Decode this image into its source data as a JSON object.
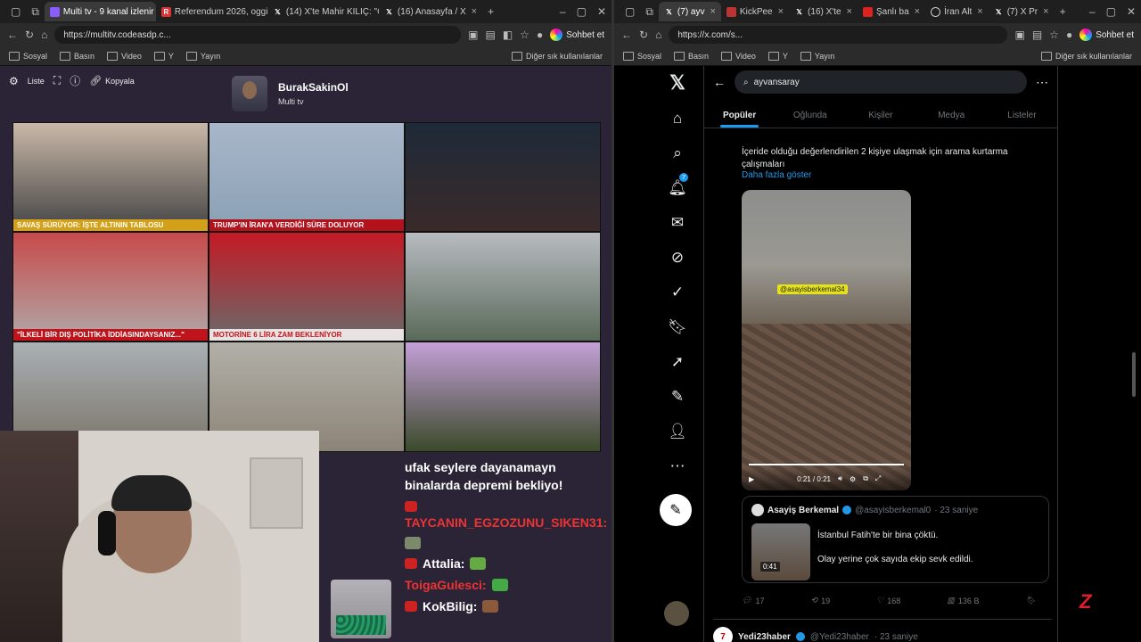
{
  "left_browser": {
    "tabs": [
      {
        "label": "Multi tv - 9 kanal izlenir",
        "fav_color": "#8a5cff",
        "active": true
      },
      {
        "label": "Referendum 2026, oggi",
        "fav_color": "#d33",
        "active": false
      },
      {
        "label": "(14) X'te Mahir KILIÇ: \"G",
        "fav_color": "#111",
        "active": false
      },
      {
        "label": "(16) Anasayfa / X",
        "fav_color": "#111",
        "active": false
      }
    ],
    "url": "https://multitv.codeasdp.c...",
    "copilot_label": "Sohbet et",
    "bookmarks": [
      "Sosyal",
      "Basın",
      "Video",
      "Y",
      "Yayın"
    ],
    "bookmarks_other": "Diğer sık kullanılanlar"
  },
  "multitv": {
    "toolbar": {
      "list_label": "Liste",
      "copy_label": "Kopyala"
    },
    "profile": {
      "name": "BurakSakinOl",
      "subtitle": "Multi tv"
    },
    "tiles": [
      {
        "caption": "SAVAŞ SÜRÜYOR: İŞTE ALTININ TABLOSU",
        "cap_bg": "#d4a017",
        "bg": "linear-gradient(#c9b8a8,#444)"
      },
      {
        "caption": "TRUMP'IN İRAN'A VERDİĞİ SÜRE DOLUYOR",
        "cap_bg": "#b3121d",
        "bg": "linear-gradient(#a8b7c9,#8aa0b4)"
      },
      {
        "caption": "",
        "cap_bg": "transparent",
        "bg": "linear-gradient(#1e2a38,#3a2a2a)"
      },
      {
        "caption": "\"İLKELİ BİR DIŞ POLİTİKA İDDİASINDAYSANIZ...\"",
        "cap_bg": "#c0141c",
        "bg": "linear-gradient(#c84a4a,#b0a8a8)"
      },
      {
        "caption": "MOTORİNE 6 LİRA ZAM BEKLENİYOR",
        "cap_bg": "#e8e2e2",
        "bg": "linear-gradient(#c41a24,#6a6a6a)"
      },
      {
        "caption": "",
        "cap_bg": "transparent",
        "bg": "linear-gradient(#b8bcc0,#5a6a5a)"
      },
      {
        "caption": "",
        "cap_bg": "transparent",
        "bg": "linear-gradient(#aab0b4,#7a7468)"
      },
      {
        "caption": "",
        "cap_bg": "transparent",
        "bg": "linear-gradient(#b2b0a8,#8c8478)"
      },
      {
        "caption": "",
        "cap_bg": "transparent",
        "bg": "linear-gradient(#c4a0d8,#3a4a2a)"
      }
    ]
  },
  "chat": {
    "big_message": "ufak seylere dayanamayn binalarda depremi bekliyo!",
    "messages": [
      {
        "user": "TAYCANIN_EGZOZUNU_SIKEN31:",
        "color": "#e33"
      },
      {
        "user": "Attalia:",
        "color": "#fff"
      },
      {
        "user": "ToigaGulesci:",
        "color": "#e33"
      },
      {
        "user": "KokBilig:",
        "color": "#fff"
      }
    ]
  },
  "right_browser": {
    "tabs": [
      {
        "label": "(7) ayv",
        "active": true
      },
      {
        "label": "KickPee",
        "active": false
      },
      {
        "label": "(16) X'te",
        "active": false
      },
      {
        "label": "Şanlı ba",
        "active": false
      },
      {
        "label": "İran Alt",
        "active": false
      },
      {
        "label": "(7) X Pr",
        "active": false
      }
    ],
    "url": "https://x.com/s...",
    "copilot_label": "Sohbet et",
    "bookmarks": [
      "Sosyal",
      "Basın",
      "Video",
      "Y",
      "Yayın"
    ],
    "bookmarks_other": "Diğer sık kullanılanlar"
  },
  "x": {
    "search_value": "ayvansaray",
    "notification_count": "7",
    "tabs": [
      "Popüler",
      "Oğlunda",
      "Kişiler",
      "Medya",
      "Listeler"
    ],
    "tweet_text": "İçeride olduğu değerlendirilen 2 kişiye ulaşmak için arama kurtarma çalışmaları",
    "show_more": "Daha fazla göster",
    "video_tag": "@asayisberkemal34",
    "video_time": "0:21 / 0:21",
    "quote": {
      "name": "Asayiş Berkemal",
      "handle": "@asayisberkemal0",
      "time": "· 23 saniye",
      "line1": "İstanbul Fatih'te bir bina çöktü.",
      "line2": "Olay yerine çok sayıda ekip sevk edildi.",
      "duration": "0:41"
    },
    "actions": {
      "replies": "17",
      "reposts": "19",
      "likes": "168",
      "views": "136 B"
    },
    "next_tweet": {
      "name": "Yedi23haber",
      "handle": "@Yedi23haber",
      "time": "· 23 saniye",
      "avatar_text": "7"
    }
  },
  "colors": {
    "x_blue": "#1d9bf0",
    "multitv_bg": "#2a2436",
    "chat_red": "#e33"
  }
}
